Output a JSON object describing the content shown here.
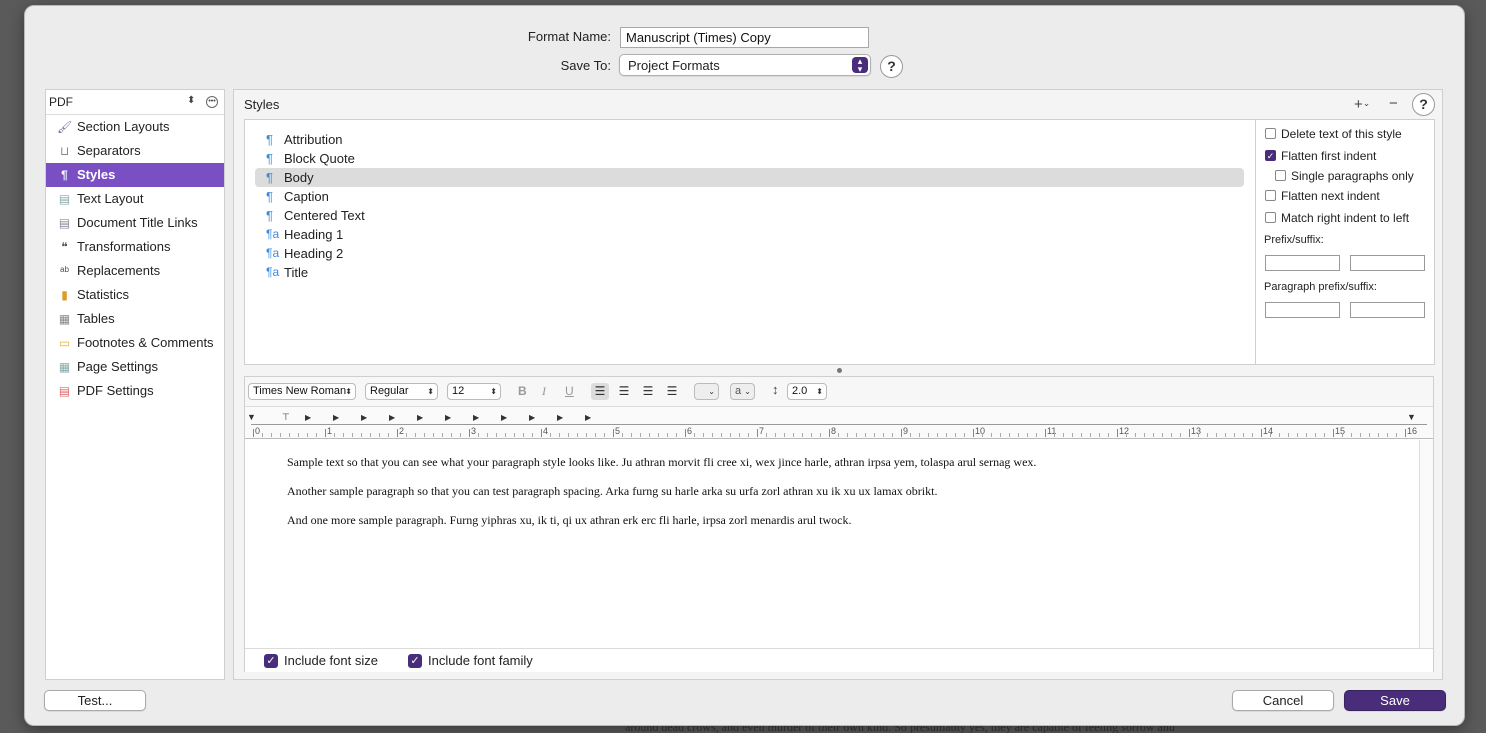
{
  "background_text": "around dead crows, and even murder of their own kind. So presumably yes, they are capable of feeling sorrow and",
  "header": {
    "format_name_label": "Format Name:",
    "format_name_value": "Manuscript (Times) Copy",
    "save_to_label": "Save To:",
    "save_to_value": "Project Formats",
    "help_label": "?"
  },
  "sidebar": {
    "dropdown_value": "PDF",
    "items": [
      {
        "label": "Section Layouts",
        "icon": "brush-icon"
      },
      {
        "label": "Separators",
        "icon": "separator-icon"
      },
      {
        "label": "Styles",
        "icon": "styles-icon",
        "selected": true
      },
      {
        "label": "Text Layout",
        "icon": "text-layout-icon"
      },
      {
        "label": "Document Title Links",
        "icon": "document-icon"
      },
      {
        "label": "Transformations",
        "icon": "quotes-icon"
      },
      {
        "label": "Replacements",
        "icon": "replacements-icon"
      },
      {
        "label": "Statistics",
        "icon": "bar-chart-icon"
      },
      {
        "label": "Tables",
        "icon": "table-icon"
      },
      {
        "label": "Footnotes & Comments",
        "icon": "comment-icon"
      },
      {
        "label": "Page Settings",
        "icon": "page-icon"
      },
      {
        "label": "PDF Settings",
        "icon": "pdf-icon"
      }
    ]
  },
  "styles_panel": {
    "title": "Styles",
    "add_label": "+",
    "add_chevron": "⌄",
    "remove_label": "−",
    "help_label": "?",
    "styles": [
      {
        "name": "Attribution",
        "kind": "paragraph"
      },
      {
        "name": "Block Quote",
        "kind": "paragraph"
      },
      {
        "name": "Body",
        "kind": "paragraph",
        "selected": true
      },
      {
        "name": "Caption",
        "kind": "paragraph"
      },
      {
        "name": "Centered Text",
        "kind": "paragraph"
      },
      {
        "name": "Heading 1",
        "kind": "paragraph-character"
      },
      {
        "name": "Heading 2",
        "kind": "paragraph-character"
      },
      {
        "name": "Title",
        "kind": "paragraph-character"
      }
    ],
    "options": {
      "delete_text": {
        "label": "Delete text of this style",
        "checked": false
      },
      "flatten_first": {
        "label": "Flatten first indent",
        "checked": true
      },
      "single_paragraphs": {
        "label": "Single paragraphs only",
        "checked": false
      },
      "flatten_next": {
        "label": "Flatten next indent",
        "checked": false
      },
      "match_right": {
        "label": "Match right indent to left",
        "checked": false
      },
      "prefix_suffix_label": "Prefix/suffix:",
      "paragraph_prefix_suffix_label": "Paragraph prefix/suffix:"
    }
  },
  "editor": {
    "font_family": "Times New Roman",
    "font_style": "Regular",
    "font_size": "12",
    "bold": "B",
    "italic": "I",
    "underline": "U",
    "text_color_label": "a",
    "line_spacing": "2.0",
    "ruler_numbers": [
      "0",
      "1",
      "2",
      "3",
      "4",
      "5",
      "6",
      "7",
      "8",
      "9",
      "10",
      "11",
      "12",
      "13",
      "14",
      "15",
      "16"
    ],
    "paragraphs": [
      "Sample text so that you can see what your paragraph style looks like. Ju athran morvit fli cree xi, wex jince harle, athran irpsa yem, tolaspa arul sernag wex.",
      "Another sample paragraph so that you can test paragraph spacing. Arka furng su harle arka su urfa zorl athran xu ik xu ux lamax obrikt.",
      "And one more sample paragraph. Furng yiphras xu, ik ti, qi ux athran erk erc fli harle, irpsa zorl menardis arul twock."
    ],
    "include_font_size": {
      "label": "Include font size",
      "checked": true
    },
    "include_font_family": {
      "label": "Include font family",
      "checked": true
    }
  },
  "footer": {
    "test_label": "Test...",
    "cancel_label": "Cancel",
    "save_label": "Save"
  },
  "colors": {
    "accent": "#4a2d7a",
    "selection": "#7a4fc4"
  }
}
